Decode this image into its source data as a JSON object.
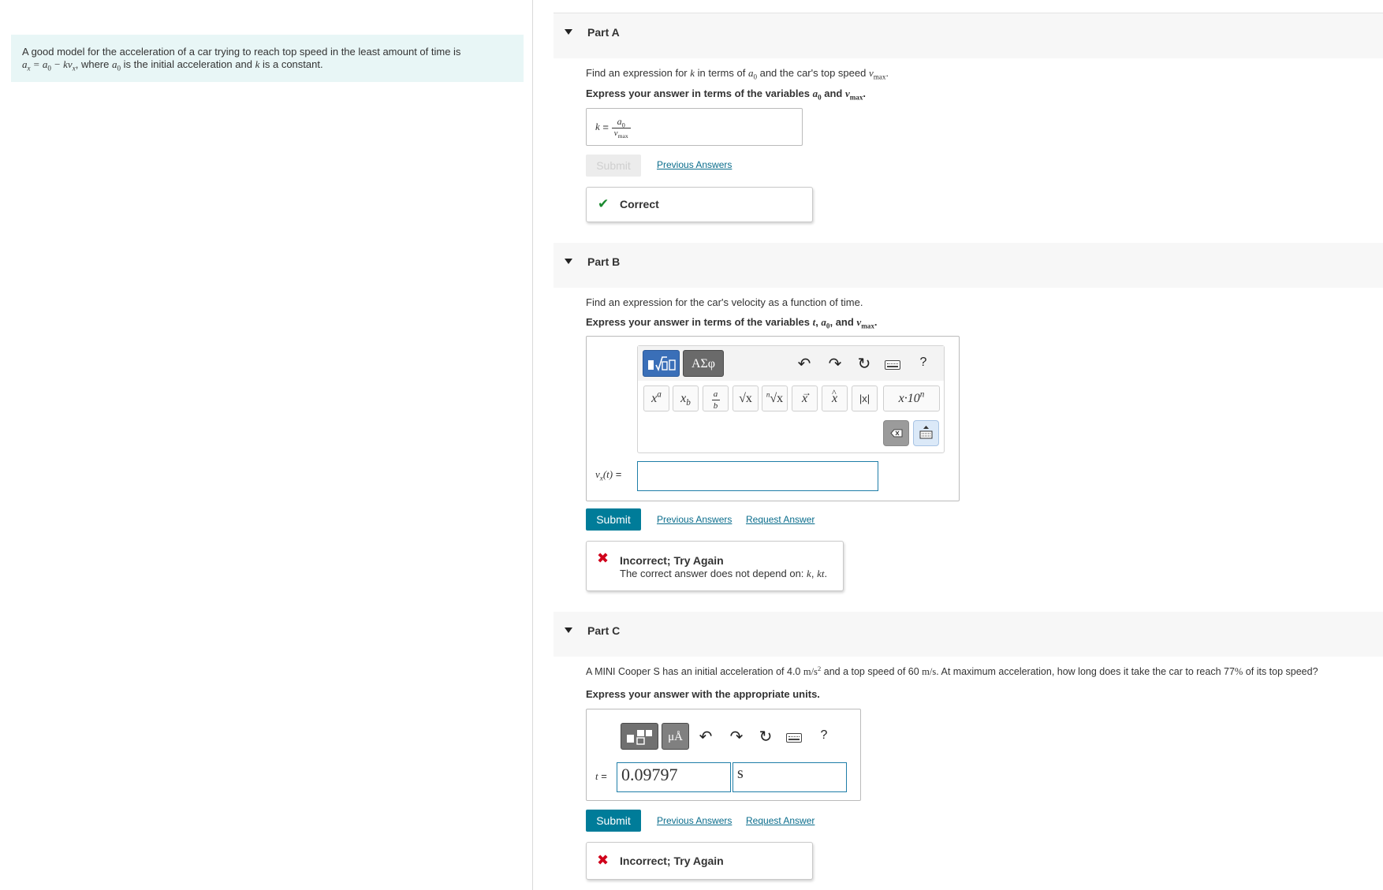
{
  "problem": {
    "intro": "A good model for the acceleration of a car trying to reach top speed in the least amount of time is",
    "model_lhs": "a",
    "model_lhs_sub": "x",
    "model_rhs": " = a",
    "model_rhs_sub": "0",
    "model_minus": " − kv",
    "model_minus_sub": "x",
    "where": ", where ",
    "a0": "a",
    "a0_sub": "0",
    "rest": " is the initial acceleration and ",
    "k": "k",
    "rest2": " is a constant."
  },
  "part_a": {
    "title": "Part A",
    "prompt_1": "Find an expression for ",
    "prompt_k": "k",
    "prompt_2": " in terms of ",
    "prompt_a": "a",
    "prompt_a_sub": "0",
    "prompt_3": " and the car's top speed ",
    "prompt_v": "v",
    "prompt_v_sub": "max",
    "prompt_4": ".",
    "instruction_1": "Express your answer in terms of the variables ",
    "instruction_a": "a",
    "instruction_a_sub": "0",
    "instruction_2": " and ",
    "instruction_v": "v",
    "instruction_v_sub": "max",
    "instruction_3": ".",
    "lhs": "k",
    "eq": " = ",
    "num": "a",
    "num_sub": "0",
    "den": "v",
    "den_sub": "max",
    "submit_label": "Submit",
    "previous_answers": "Previous Answers",
    "feedback": "Correct"
  },
  "part_b": {
    "title": "Part B",
    "prompt": "Find an expression for the car's velocity as a function of time.",
    "instruction_1": "Express your answer in terms of the variables ",
    "instruction_t": "t",
    "instruction_2": ", ",
    "instruction_a": "a",
    "instruction_a_sub": "0",
    "instruction_3": ", and ",
    "instruction_v": "v",
    "instruction_v_sub": "max",
    "instruction_4": ".",
    "toolbar": {
      "greek_label": "ΑΣφ",
      "help": "?",
      "sym_superscript": "x",
      "sym_superscript_sup": "a",
      "sym_subscript": "x",
      "sym_subscript_sub": "b",
      "sym_frac_num": "a",
      "sym_frac_den": "b",
      "sym_sqrt": "√x",
      "sym_nroot_index": "n",
      "sym_nroot": "√x",
      "sym_vector": "x",
      "sym_hat": "x",
      "sym_abs": "|x|",
      "sym_sci": "x·10",
      "sym_sci_sup": "n"
    },
    "lhs": "v",
    "lhs_sub": "x",
    "lhs_arg": "(t)",
    "eq": " = ",
    "input_value": "",
    "submit_label": "Submit",
    "previous_answers": "Previous Answers",
    "request_answer": "Request Answer",
    "feedback": "Incorrect; Try Again",
    "feedback_detail_1": "The correct answer does not depend on: ",
    "feedback_detail_k": "k",
    "feedback_detail_2": ", ",
    "feedback_detail_kt": "kt",
    "feedback_detail_3": "."
  },
  "part_c": {
    "title": "Part C",
    "prompt_1": "A MINI Cooper S has an initial acceleration of 4.0 ",
    "prompt_unit1": "m/s",
    "prompt_unit1_sup": "2",
    "prompt_2": " and a top speed of 60 ",
    "prompt_unit2": "m/s",
    "prompt_3": ". At maximum acceleration, how long does it take the car to reach 77",
    "prompt_pct": "%",
    "prompt_4": " of its top speed?",
    "instruction": "Express your answer with the appropriate units.",
    "toolbar": {
      "units_label": "μÅ",
      "help": "?"
    },
    "lhs": "t",
    "eq": " = ",
    "value": "0.09797",
    "unit": "s",
    "submit_label": "Submit",
    "previous_answers": "Previous Answers",
    "request_answer": "Request Answer",
    "feedback": "Incorrect; Try Again"
  },
  "colors": {
    "accent": "#007c99",
    "problem_bg": "#e8f6f6",
    "correct": "#1b8a2f",
    "incorrect": "#d0021b",
    "link": "#0a6d8c"
  }
}
